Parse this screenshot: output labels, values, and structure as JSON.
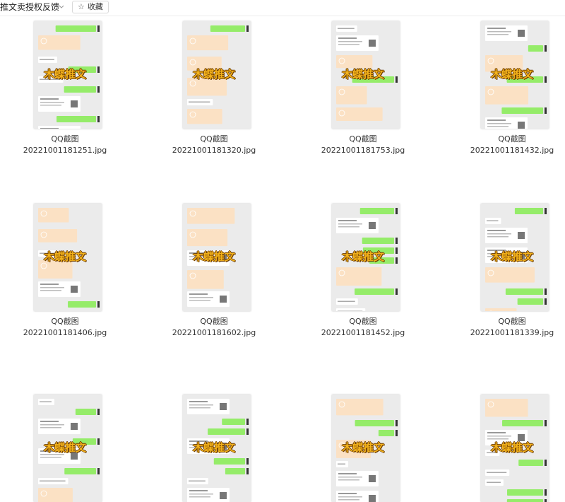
{
  "breadcrumb": {
    "title": "推文卖授权反馈"
  },
  "toolbar": {
    "favorite_label": "收藏"
  },
  "watermark": "木蝶推文",
  "files": [
    {
      "name": "QQ截图",
      "filename": "20221001181251.jpg"
    },
    {
      "name": "QQ截图",
      "filename": "20221001181320.jpg"
    },
    {
      "name": "QQ截图",
      "filename": "20221001181753.jpg"
    },
    {
      "name": "QQ截图",
      "filename": "20221001181432.jpg"
    },
    {
      "name": "QQ截图",
      "filename": "20221001181406.jpg"
    },
    {
      "name": "QQ截图",
      "filename": "20221001181602.jpg"
    },
    {
      "name": "QQ截图",
      "filename": "20221001181452.jpg"
    },
    {
      "name": "QQ截图",
      "filename": "20221001181339.jpg"
    },
    {
      "name": "",
      "filename": ""
    },
    {
      "name": "",
      "filename": ""
    },
    {
      "name": "",
      "filename": ""
    },
    {
      "name": "",
      "filename": ""
    }
  ],
  "colors": {
    "bubble_green": "#95ec69",
    "card_peach": "#fbe1c4",
    "chat_bg": "#ebebeb"
  }
}
